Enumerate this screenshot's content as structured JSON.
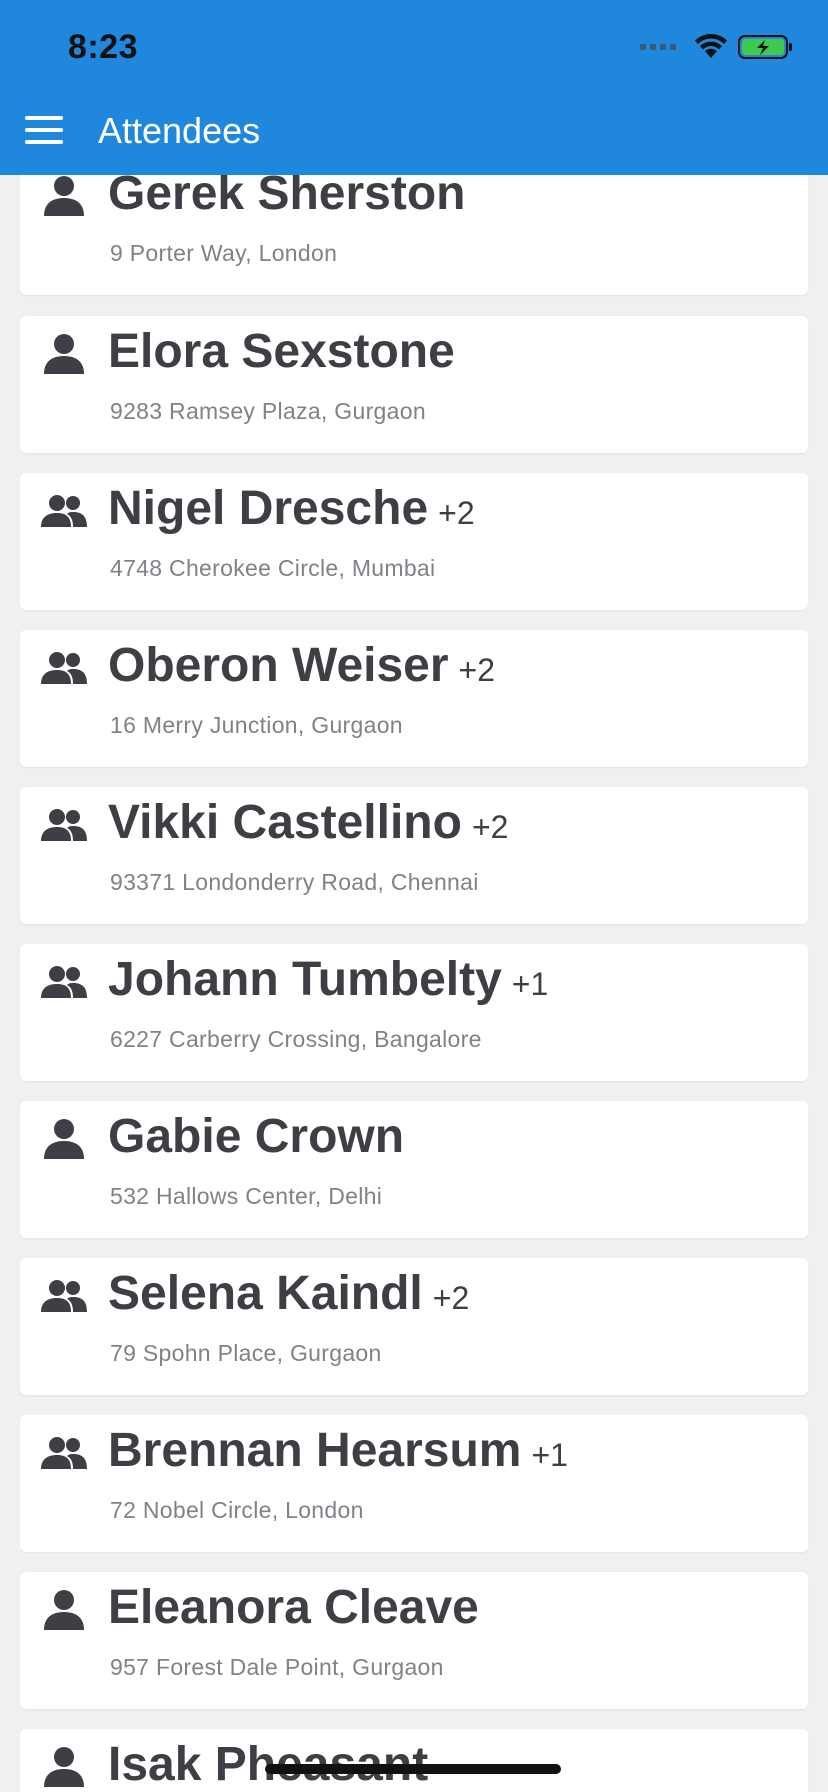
{
  "status_bar": {
    "time": "8:23"
  },
  "header": {
    "title": "Attendees",
    "menu_icon": "hamburger-menu-icon",
    "background_color": "#1f88dc"
  },
  "attendees": [
    {
      "name": "Gerek Sherston",
      "guests": "",
      "address": "9 Porter Way, London",
      "icon": "single-person-icon"
    },
    {
      "name": "Elora Sexstone",
      "guests": "",
      "address": "9283 Ramsey Plaza, Gurgaon",
      "icon": "single-person-icon"
    },
    {
      "name": "Nigel Dresche",
      "guests": "+2",
      "address": "4748 Cherokee Circle, Mumbai",
      "icon": "group-icon"
    },
    {
      "name": "Oberon Weiser",
      "guests": "+2",
      "address": "16 Merry Junction, Gurgaon",
      "icon": "group-icon"
    },
    {
      "name": "Vikki Castellino",
      "guests": "+2",
      "address": "93371 Londonderry Road, Chennai",
      "icon": "group-icon"
    },
    {
      "name": "Johann Tumbelty",
      "guests": "+1",
      "address": "6227 Carberry Crossing, Bangalore",
      "icon": "group-icon"
    },
    {
      "name": "Gabie Crown",
      "guests": "",
      "address": "532 Hallows Center, Delhi",
      "icon": "single-person-icon"
    },
    {
      "name": "Selena Kaindl",
      "guests": "+2",
      "address": "79 Spohn Place, Gurgaon",
      "icon": "group-icon"
    },
    {
      "name": "Brennan Hearsum",
      "guests": "+1",
      "address": "72 Nobel Circle, London",
      "icon": "group-icon"
    },
    {
      "name": "Eleanora Cleave",
      "guests": "",
      "address": "957 Forest Dale Point, Gurgaon",
      "icon": "single-person-icon"
    },
    {
      "name": "Isak Pheasant",
      "guests": "",
      "address": "",
      "icon": "single-person-icon"
    }
  ]
}
